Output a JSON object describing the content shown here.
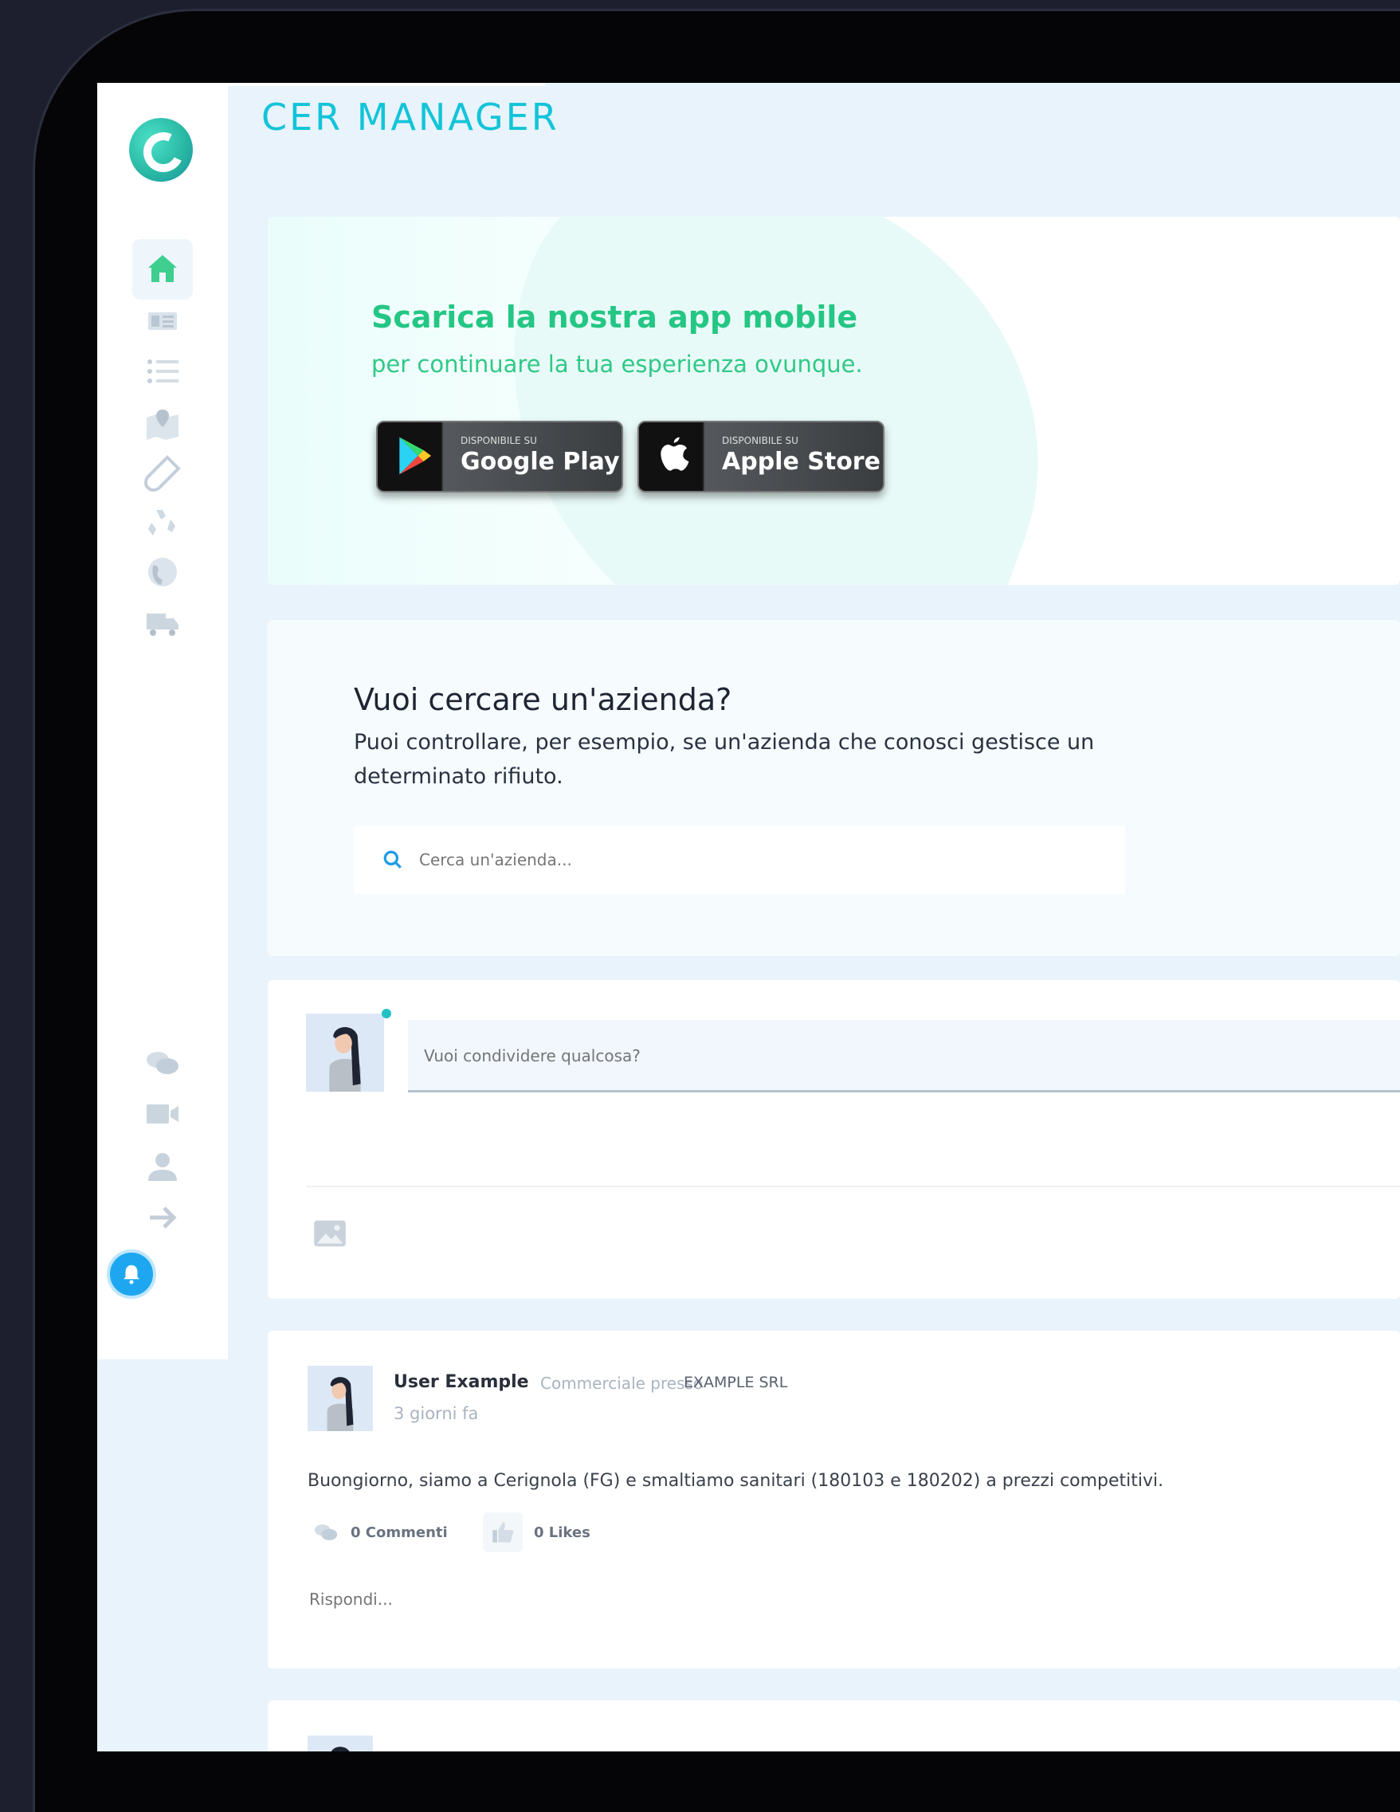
{
  "app": {
    "title": "CER MANAGER"
  },
  "sidebar": {
    "items": [
      {
        "icon": "home-icon",
        "active": true
      },
      {
        "icon": "newspaper-icon"
      },
      {
        "icon": "list-icon"
      },
      {
        "icon": "map-icon"
      },
      {
        "icon": "test-tube-icon"
      },
      {
        "icon": "recycle-icon"
      },
      {
        "icon": "globe-icon"
      },
      {
        "icon": "truck-icon"
      },
      {
        "icon": "chat-icon"
      },
      {
        "icon": "video-icon"
      },
      {
        "icon": "user-icon"
      },
      {
        "icon": "logout-icon"
      }
    ],
    "notification_icon": "bell-icon"
  },
  "promo": {
    "heading": "Scarica la nostra app mobile",
    "subheading": "per continuare la tua esperienza ovunque.",
    "google_small": "DISPONIBILE SU",
    "google_big": "Google Play",
    "apple_small": "DISPONIBILE SU",
    "apple_big": "Apple Store"
  },
  "search": {
    "title": "Vuoi cercare un'azienda?",
    "description": "Puoi controllare, per esempio, se un'azienda che conosci gestisce un determinato rifiuto.",
    "placeholder": "Cerca un'azienda..."
  },
  "compose": {
    "placeholder": "Vuoi condividere qualcosa?"
  },
  "post": {
    "author": "User Example",
    "role": "Commerciale presso",
    "company": "EXAMPLE SRL",
    "time": "3 giorni fa",
    "text": "Buongiorno, siamo a Cerignola (FG) e smaltiamo sanitari (180103 e 180202) a prezzi competitivi.",
    "comments": "0 Commenti",
    "likes": "0 Likes",
    "reply_placeholder": "Rispondi..."
  },
  "colors": {
    "accent_green": "#24c684",
    "brand_cyan": "#12c4d8",
    "notification_blue": "#1ea7f0"
  }
}
